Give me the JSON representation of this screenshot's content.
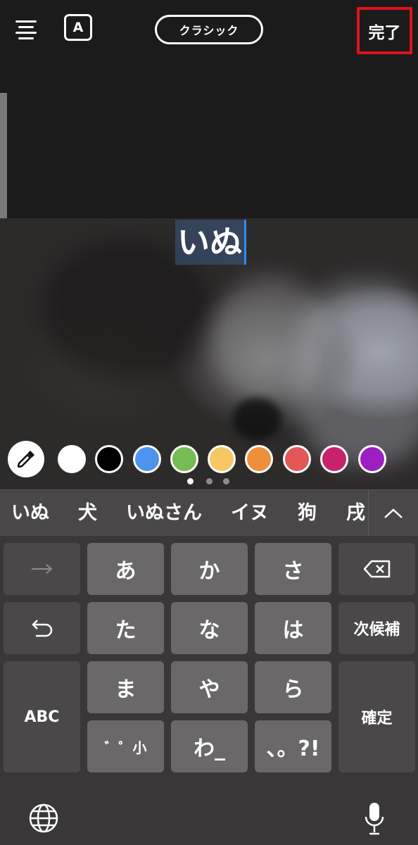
{
  "topbar": {
    "font_label": "A",
    "style_label": "クラシック",
    "done_label": "完了"
  },
  "editor": {
    "text": "いぬ"
  },
  "palette": {
    "colors": [
      "#ffffff",
      "#000000",
      "#4f94ec",
      "#75bc55",
      "#f5c864",
      "#ef8e3b",
      "#e35757",
      "#c8226c",
      "#9b1fc1"
    ],
    "page_count": 3,
    "active_page": 1
  },
  "candidates": [
    "いぬ",
    "犬",
    "いぬさん",
    "イヌ",
    "狗",
    "戌"
  ],
  "keyboard": {
    "row1": [
      "→",
      "あ",
      "か",
      "さ",
      "⌫"
    ],
    "row2": [
      "↶",
      "た",
      "な",
      "は",
      "次候補"
    ],
    "row3": [
      "ま",
      "や",
      "ら"
    ],
    "row4": [
      "゛゜小",
      "わ_",
      "、。?!"
    ],
    "abc": "ABC",
    "confirm": "確定"
  }
}
